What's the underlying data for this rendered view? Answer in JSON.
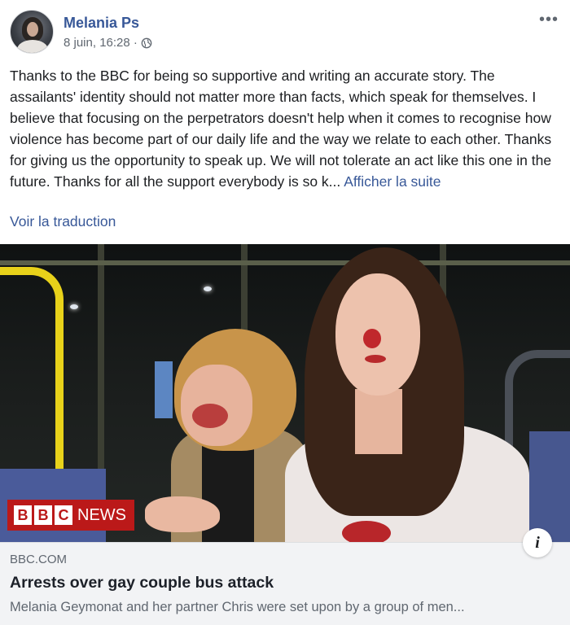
{
  "post": {
    "author": "Melania Ps",
    "timestamp": "8 juin, 16:28 ·",
    "text": "Thanks to the BBC for being so supportive and writing an accurate story. The assailants' identity should not matter more than facts, which speak for themselves. I believe that focusing on the perpetrators doesn't help when it comes to recognise how violence has become part of our daily life and the way we relate to each other. Thanks for giving us the opportunity to speak up. We will not tolerate an act like this one in the future. Thanks for all the support everybody is so k...",
    "see_more": "Afficher la suite",
    "translate": "Voir la traduction",
    "icons": {
      "privacy": "globe-icon",
      "menu": "more-options-icon",
      "info": "info-icon"
    }
  },
  "image": {
    "badge_letters": [
      "B",
      "B",
      "C"
    ],
    "badge_text": "NEWS",
    "badge_color": "#bb1919"
  },
  "link": {
    "source": "BBC.COM",
    "title": "Arrests over gay couple bus attack",
    "description": "Melania Geymonat and her partner Chris were set upon by a group of men..."
  },
  "colors": {
    "link": "#385898",
    "text": "#1c1e21",
    "secondary": "#606770",
    "card_bg": "#f2f3f5"
  }
}
